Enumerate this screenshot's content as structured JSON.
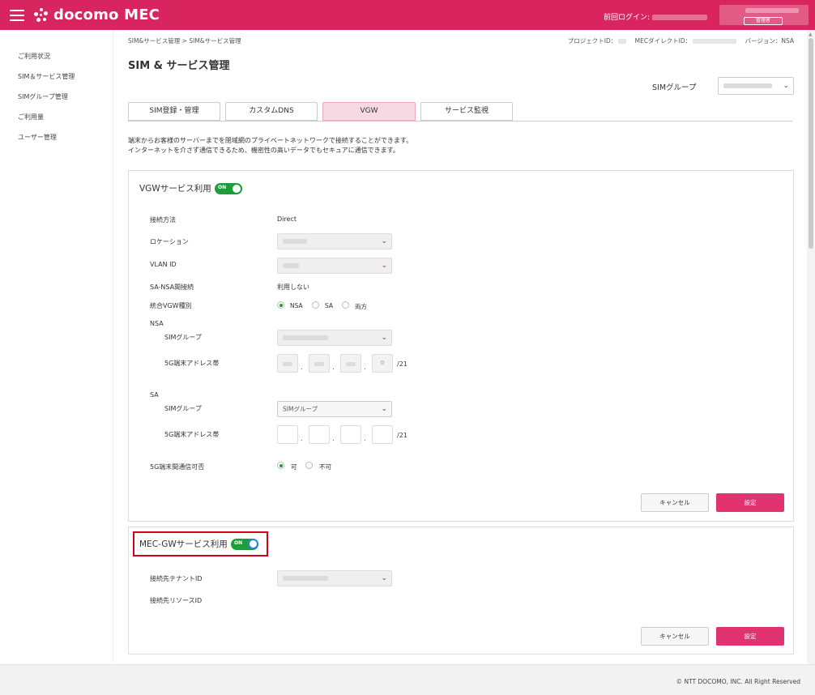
{
  "header": {
    "logo_text": "docomo MEC",
    "last_login_label": "前回ログイン:",
    "role_badge": "管理者"
  },
  "sidebar": {
    "items": [
      {
        "label": "ご利用状況"
      },
      {
        "label": "SIM＆サービス管理"
      },
      {
        "label": "SIMグループ管理"
      },
      {
        "label": "ご利用量"
      },
      {
        "label": "ユーザー管理"
      }
    ]
  },
  "breadcrumb": "SIM&サービス管理 > SIM&サービス管理",
  "project": {
    "project_id_label": "プロジェクトID：",
    "mec_directory_id_label": "MECダイレクトID：",
    "version_label": "バージョン：NSA"
  },
  "page_title": "SIM & サービス管理",
  "sim_group_selector": {
    "label": "SIMグループ"
  },
  "tabs": [
    {
      "label": "SIM登録・管理"
    },
    {
      "label": "カスタムDNS"
    },
    {
      "label": "VGW"
    },
    {
      "label": "サービス監視"
    }
  ],
  "description": {
    "line1": "端末からお客様のサーバーまでを閉域網のプライベートネットワークで接続することができます。",
    "line2": "インターネットを介さず通信できるため、機密性の高いデータでもセキュアに通信できます。"
  },
  "vgw_panel": {
    "title": "VGWサービス利用",
    "toggle_label": "ON",
    "connection_method_label": "接続方法",
    "connection_method_value": "Direct",
    "location_label": "ロケーション",
    "vlan_label": "VLAN ID",
    "sa_nsa_label": "SA-NSA間接続",
    "sa_nsa_value": "利用しない",
    "integrated_type_label": "統合VGW種別",
    "integrated_type_options": [
      "NSA",
      "SA",
      "両方"
    ],
    "nsa_heading": "NSA",
    "nsa_sim_group_label": "SIMグループ",
    "nsa_address_label": "5G端末アドレス帯",
    "nsa_address_last_octet": "0",
    "nsa_prefix": "/21",
    "sa_heading": "SA",
    "sa_sim_group_label": "SIMグループ",
    "sa_sim_group_value": "SIMグループ",
    "sa_address_label": "5G端末アドレス帯",
    "sa_prefix": "/21",
    "inter_terminal_label": "5G端末間通信可否",
    "inter_terminal_options": [
      "可",
      "不可"
    ],
    "cancel_label": "キャンセル",
    "submit_label": "設定"
  },
  "mec_panel": {
    "title": "MEC-GWサービス利用",
    "toggle_label": "ON",
    "tenant_label": "接続先テナントID",
    "resource_label": "接続先リソースID",
    "cancel_label": "キャンセル",
    "submit_label": "設定"
  },
  "footer": {
    "copyright": "© NTT DOCOMO, INC. All Right Reserved"
  },
  "colors": {
    "brand": "#d8245f",
    "toggle_on": "#1f9d3a",
    "primary_button": "#e0336f",
    "highlight": "#d0021b"
  }
}
